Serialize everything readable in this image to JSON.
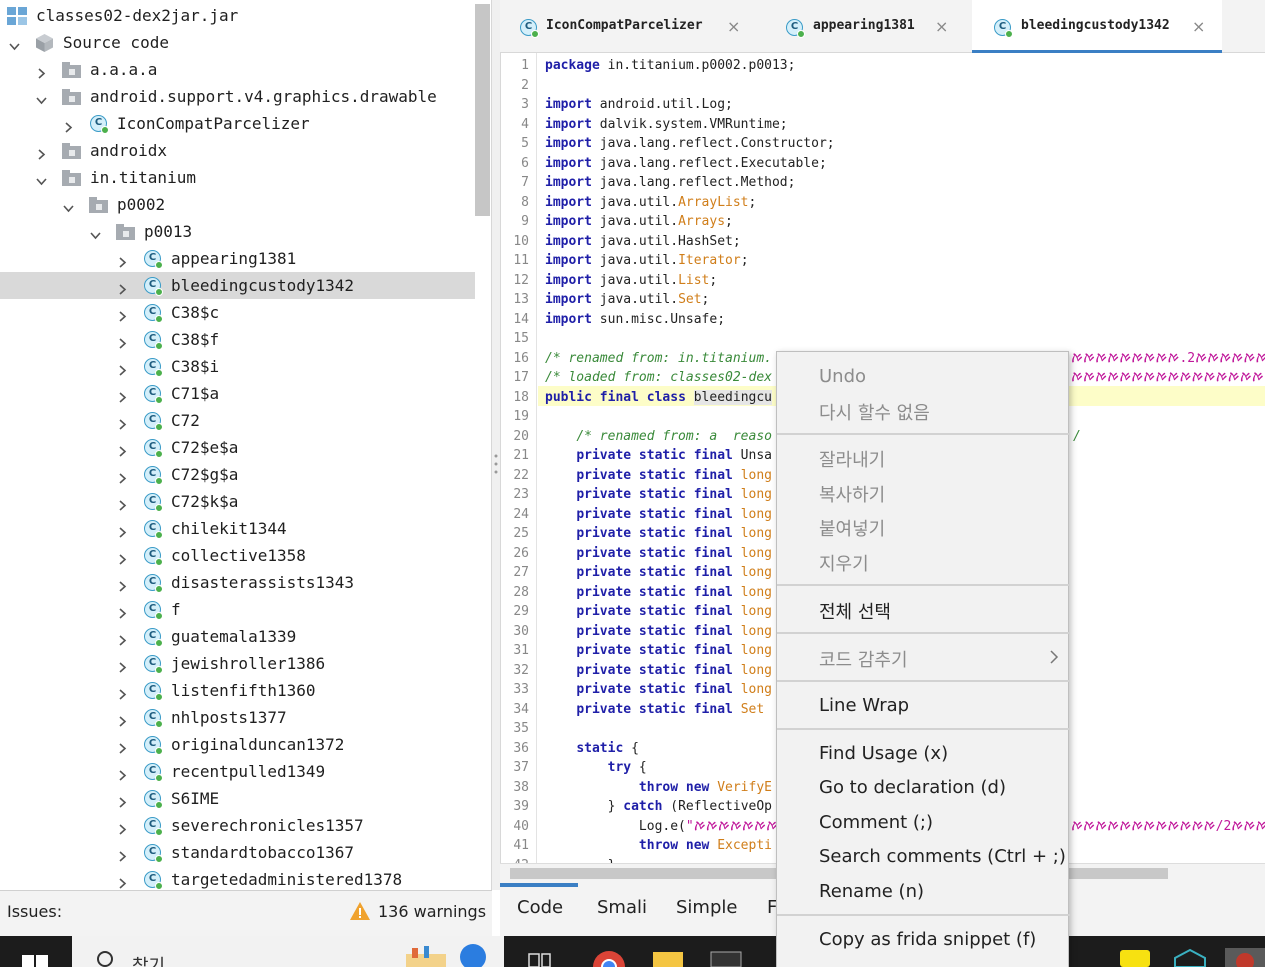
{
  "tree": {
    "root_label": "classes02-dex2jar.jar",
    "source_label": "Source code",
    "rows": [
      {
        "label": "a.a.a.a",
        "depth": 1,
        "arrow": "right",
        "icon": "package"
      },
      {
        "label": "android.support.v4.graphics.drawable",
        "depth": 1,
        "arrow": "down",
        "icon": "package"
      },
      {
        "label": "IconCompatParcelizer",
        "depth": 2,
        "arrow": "right",
        "icon": "class"
      },
      {
        "label": "androidx",
        "depth": 1,
        "arrow": "right",
        "icon": "package"
      },
      {
        "label": "in.titanium",
        "depth": 1,
        "arrow": "down",
        "icon": "package"
      },
      {
        "label": "p0002",
        "depth": 2,
        "arrow": "down",
        "icon": "package"
      },
      {
        "label": "p0013",
        "depth": 3,
        "arrow": "down",
        "icon": "package"
      },
      {
        "label": "appearing1381",
        "depth": 4,
        "arrow": "right",
        "icon": "class"
      },
      {
        "label": "bleedingcustody1342",
        "depth": 4,
        "arrow": "right",
        "icon": "class",
        "selected": true
      },
      {
        "label": "C38$c",
        "depth": 4,
        "arrow": "right",
        "icon": "class"
      },
      {
        "label": "C38$f",
        "depth": 4,
        "arrow": "right",
        "icon": "class"
      },
      {
        "label": "C38$i",
        "depth": 4,
        "arrow": "right",
        "icon": "class"
      },
      {
        "label": "C71$a",
        "depth": 4,
        "arrow": "right",
        "icon": "class"
      },
      {
        "label": "C72",
        "depth": 4,
        "arrow": "right",
        "icon": "class"
      },
      {
        "label": "C72$e$a",
        "depth": 4,
        "arrow": "right",
        "icon": "class"
      },
      {
        "label": "C72$g$a",
        "depth": 4,
        "arrow": "right",
        "icon": "class"
      },
      {
        "label": "C72$k$a",
        "depth": 4,
        "arrow": "right",
        "icon": "class"
      },
      {
        "label": "chilekit1344",
        "depth": 4,
        "arrow": "right",
        "icon": "class"
      },
      {
        "label": "collective1358",
        "depth": 4,
        "arrow": "right",
        "icon": "class"
      },
      {
        "label": "disasterassists1343",
        "depth": 4,
        "arrow": "right",
        "icon": "class"
      },
      {
        "label": "f",
        "depth": 4,
        "arrow": "right",
        "icon": "class"
      },
      {
        "label": "guatemala1339",
        "depth": 4,
        "arrow": "right",
        "icon": "class"
      },
      {
        "label": "jewishroller1386",
        "depth": 4,
        "arrow": "right",
        "icon": "class"
      },
      {
        "label": "listenfifth1360",
        "depth": 4,
        "arrow": "right",
        "icon": "class"
      },
      {
        "label": "nhlposts1377",
        "depth": 4,
        "arrow": "right",
        "icon": "class"
      },
      {
        "label": "originalduncan1372",
        "depth": 4,
        "arrow": "right",
        "icon": "class"
      },
      {
        "label": "recentpulled1349",
        "depth": 4,
        "arrow": "right",
        "icon": "class"
      },
      {
        "label": "S6IME",
        "depth": 4,
        "arrow": "right",
        "icon": "class"
      },
      {
        "label": "severechronicles1357",
        "depth": 4,
        "arrow": "right",
        "icon": "class"
      },
      {
        "label": "standardtobacco1367",
        "depth": 4,
        "arrow": "right",
        "icon": "class"
      },
      {
        "label": "targetedadministered1378",
        "depth": 4,
        "arrow": "right",
        "icon": "class"
      }
    ]
  },
  "issues": {
    "label": "Issues:",
    "warnings": "136 warnings"
  },
  "tabs": [
    {
      "label": "IconCompatParcelizer",
      "close": "×",
      "active": false
    },
    {
      "label": "appearing1381",
      "close": "×",
      "active": false
    },
    {
      "label": "bleedingcustody1342",
      "close": "×",
      "active": true
    }
  ],
  "code": {
    "highlight_line": 18,
    "lines": [
      {
        "n": "1",
        "html": "<span class='kw'>package</span> in.titanium.p0002.p0013;"
      },
      {
        "n": "2",
        "html": ""
      },
      {
        "n": "3",
        "html": "<span class='kw'>import</span> android.util.Log;"
      },
      {
        "n": "4",
        "html": "<span class='kw'>import</span> dalvik.system.VMRuntime;"
      },
      {
        "n": "5",
        "html": "<span class='kw'>import</span> java.lang.reflect.Constructor;"
      },
      {
        "n": "6",
        "html": "<span class='kw'>import</span> java.lang.reflect.Executable;"
      },
      {
        "n": "7",
        "html": "<span class='kw'>import</span> java.lang.reflect.Method;"
      },
      {
        "n": "8",
        "html": "<span class='kw'>import</span> java.util.<span class='ty'>ArrayList</span>;"
      },
      {
        "n": "9",
        "html": "<span class='kw'>import</span> java.util.<span class='ty'>Arrays</span>;"
      },
      {
        "n": "10",
        "html": "<span class='kw'>import</span> java.util.HashSet;"
      },
      {
        "n": "11",
        "html": "<span class='kw'>import</span> java.util.<span class='ty'>Iterator</span>;"
      },
      {
        "n": "12",
        "html": "<span class='kw'>import</span> java.util.<span class='ty'>List</span>;"
      },
      {
        "n": "13",
        "html": "<span class='kw'>import</span> java.util.<span class='ty'>Set</span>;"
      },
      {
        "n": "14",
        "html": "<span class='kw'>import</span> sun.misc.Unsafe;"
      },
      {
        "n": "15",
        "html": ""
      },
      {
        "n": "16",
        "html": "<span class='cm'>/* renamed from: in.titanium.</span>"
      },
      {
        "n": "17",
        "html": "<span class='cm'>/* loaded from: classes02-dex</span>"
      },
      {
        "n": "18",
        "html": "<span class='kw'>public</span> <span class='kw'>final</span> <span class='kw'>class</span> <span class='selw'>bleedingcu</span>"
      },
      {
        "n": "19",
        "html": ""
      },
      {
        "n": "20",
        "html": "    <span class='cm'>/* renamed from: a  reaso</span>"
      },
      {
        "n": "21",
        "html": "    <span class='kw'>private static final</span> Unsa"
      },
      {
        "n": "22",
        "html": "    <span class='kw'>private static final</span> <span class='ty'>long</span>"
      },
      {
        "n": "23",
        "html": "    <span class='kw'>private static final</span> <span class='ty'>long</span>"
      },
      {
        "n": "24",
        "html": "    <span class='kw'>private static final</span> <span class='ty'>long</span>"
      },
      {
        "n": "25",
        "html": "    <span class='kw'>private static final</span> <span class='ty'>long</span>"
      },
      {
        "n": "26",
        "html": "    <span class='kw'>private static final</span> <span class='ty'>long</span>"
      },
      {
        "n": "27",
        "html": "    <span class='kw'>private static final</span> <span class='ty'>long</span>"
      },
      {
        "n": "28",
        "html": "    <span class='kw'>private static final</span> <span class='ty'>long</span>"
      },
      {
        "n": "29",
        "html": "    <span class='kw'>private static final</span> <span class='ty'>long</span>"
      },
      {
        "n": "30",
        "html": "    <span class='kw'>private static final</span> <span class='ty'>long</span>"
      },
      {
        "n": "31",
        "html": "    <span class='kw'>private static final</span> <span class='ty'>long</span>"
      },
      {
        "n": "32",
        "html": "    <span class='kw'>private static final</span> <span class='ty'>long</span>"
      },
      {
        "n": "33",
        "html": "    <span class='kw'>private static final</span> <span class='ty'>long</span>"
      },
      {
        "n": "34",
        "html": "    <span class='kw'>private static final</span> <span class='ty'>Set</span>"
      },
      {
        "n": "35",
        "html": ""
      },
      {
        "n": "36",
        "html": "    <span class='kw'>static</span> {"
      },
      {
        "n": "37",
        "html": "        <span class='kw'>try</span> {"
      },
      {
        "n": "38",
        "html": "            <span class='kw'>throw</span> <span class='kw'>new</span> <span class='ty'>VerifyE</span>"
      },
      {
        "n": "39",
        "html": "        } <span class='kw'>catch</span> (ReflectiveOp"
      },
      {
        "n": "40",
        "html": "            Log.e(<span class='st'>\"ࠀࠀࠀࠀࠀࠀࠀࠀࠀ</span>"
      },
      {
        "n": "41",
        "html": "            <span class='kw'>throw</span> <span class='kw'>new</span> <span class='ty'>Excepti</span>"
      },
      {
        "n": "42",
        "html": "        }"
      }
    ],
    "overflow_right": [
      {
        "line": 16,
        "html": "<span class='st'>ࠀࠀࠀࠀࠀࠀࠀࠀࠀࠀࠀࠀࠀࠀࠀ2.ࠀࠀࠀࠀࠀࠀࠀࠀࠀ</span>"
      },
      {
        "line": 17,
        "html": "<span class='st'>ࠀࠀࠀࠀࠀࠀࠀࠀࠀࠀࠀࠀࠀࠀࠀࠀࠀࠀࠀࠀࠀࠀࠀࠀࠀ</span>"
      },
      {
        "line": 20,
        "html": "<span class='cm'>/</span>"
      },
      {
        "line": 40,
        "html": "<span class='st'>ࠀࠀࠀࠀࠀࠀࠀࠀࠀࠀࠀࠀ2/ࠀࠀࠀࠀࠀࠀࠀࠀࠀࠀࠀࠀ</span>"
      }
    ]
  },
  "bottom_tabs": [
    "Code",
    "Smali",
    "Simple",
    "F"
  ],
  "context_menu": {
    "undo": "Undo",
    "cannot_undo": "다시 할수 없음",
    "cut": "잘라내기",
    "copy": "복사하기",
    "paste": "붙여넣기",
    "delete": "지우기",
    "select_all": "전체 선택",
    "hide_code": "코드 감추기",
    "line_wrap": "Line Wrap",
    "find_usage": "Find Usage (x)",
    "go_to_declaration": "Go to declaration (d)",
    "comment": "Comment (;)",
    "search_comments": "Search comments (Ctrl + ;)",
    "rename": "Rename (n)",
    "copy_frida": "Copy as frida snippet (f)"
  },
  "taskbar": {
    "search_label": "찾기"
  },
  "colors": {
    "accent": "#3b7fc4",
    "highlight": "#fdfdc8",
    "keyword": "#1f1fa8",
    "type": "#d07e1a",
    "comment": "#3a8a3a",
    "string": "#c0179a"
  }
}
